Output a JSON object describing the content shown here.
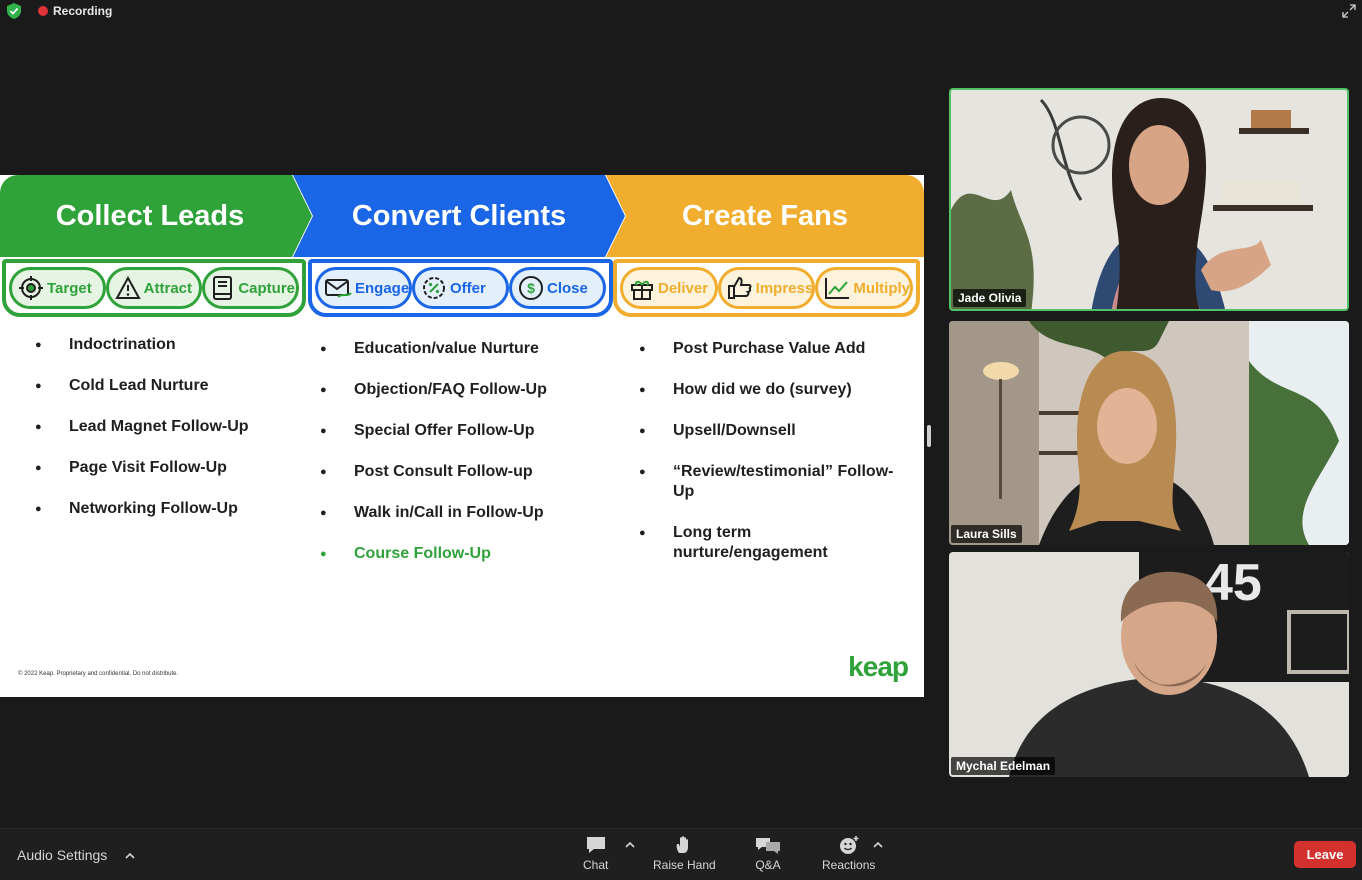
{
  "topbar": {
    "recording_label": "Recording"
  },
  "slide": {
    "banners": [
      "Collect Leads",
      "Convert Clients",
      "Create Fans"
    ],
    "pills": {
      "green": [
        "Target",
        "Attract",
        "Capture"
      ],
      "blue": [
        "Engage",
        "Offer",
        "Close"
      ],
      "yellow": [
        "Deliver",
        "Impress",
        "Multiply"
      ]
    },
    "col1": [
      "Indoctrination",
      "Cold Lead Nurture",
      "Lead Magnet Follow-Up",
      "Page Visit Follow-Up",
      "Networking Follow-Up"
    ],
    "col2": [
      "Education/value Nurture",
      "Objection/FAQ Follow-Up",
      "Special Offer Follow-Up",
      "Post Consult Follow-up",
      "Walk in/Call in Follow-Up",
      "Course Follow-Up"
    ],
    "col3": [
      "Post Purchase Value Add",
      "How did we do (survey)",
      "Upsell/Downsell",
      "“Review/testimonial” Follow-Up",
      "Long term nurture/engagement"
    ],
    "footer_note": "© 2022 Keap. Proprietary and confidential. Do not distribute.",
    "logo": "keap",
    "colors": {
      "green": "#2fa23a",
      "blue": "#1a66e6",
      "yellow": "#f0ad2e"
    }
  },
  "participants": [
    {
      "name": "Jade Olivia"
    },
    {
      "name": "Laura Sills"
    },
    {
      "name": "Mychal Edelman"
    }
  ],
  "toolbar": {
    "audio_settings": "Audio Settings",
    "chat": "Chat",
    "raise_hand": "Raise Hand",
    "qa": "Q&A",
    "reactions": "Reactions",
    "leave": "Leave"
  }
}
